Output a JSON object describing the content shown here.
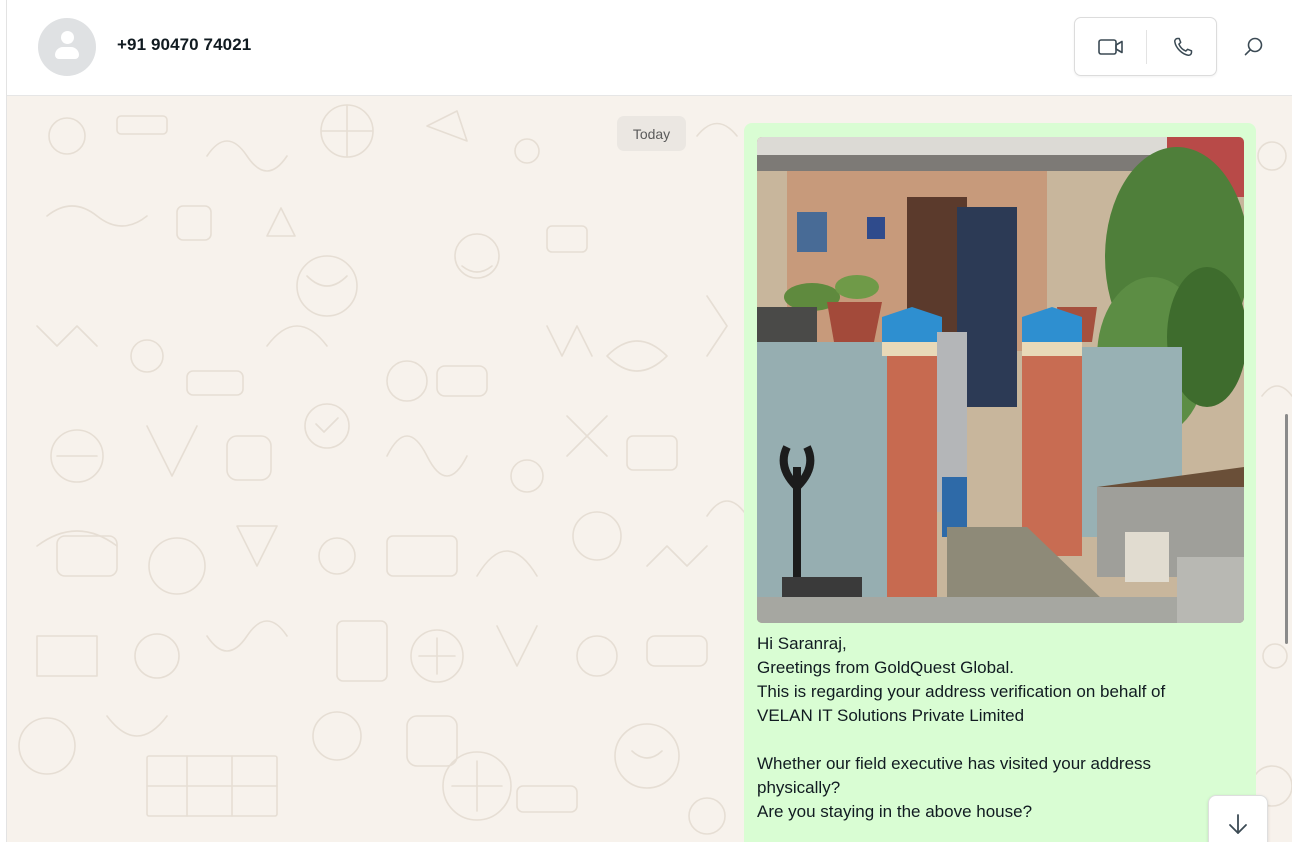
{
  "contact": {
    "name": "+91 90470 74021",
    "avatar_icon": "default-person-avatar"
  },
  "header": {
    "video_call_icon": "video-camera-icon",
    "voice_call_icon": "phone-icon",
    "search_icon": "search-icon"
  },
  "chat": {
    "date_separator": "Today",
    "message": {
      "media": "photo of a house entrance with gate pillars and potted plants",
      "lines": [
        "Hi Saranraj,",
        "Greetings from GoldQuest Global.",
        "This is regarding your address verification on behalf of",
        "VELAN IT Solutions Private Limited",
        "",
        "Whether our field executive has visited your address",
        "physically?",
        "Are you staying in the above house?"
      ]
    },
    "scroll_down_icon": "arrow-down-icon"
  },
  "colors": {
    "chat_background": "#f7f2ec",
    "outgoing_bubble": "#d9fdd3",
    "date_chip": "#ebe7e2",
    "header_background": "#ffffff"
  }
}
